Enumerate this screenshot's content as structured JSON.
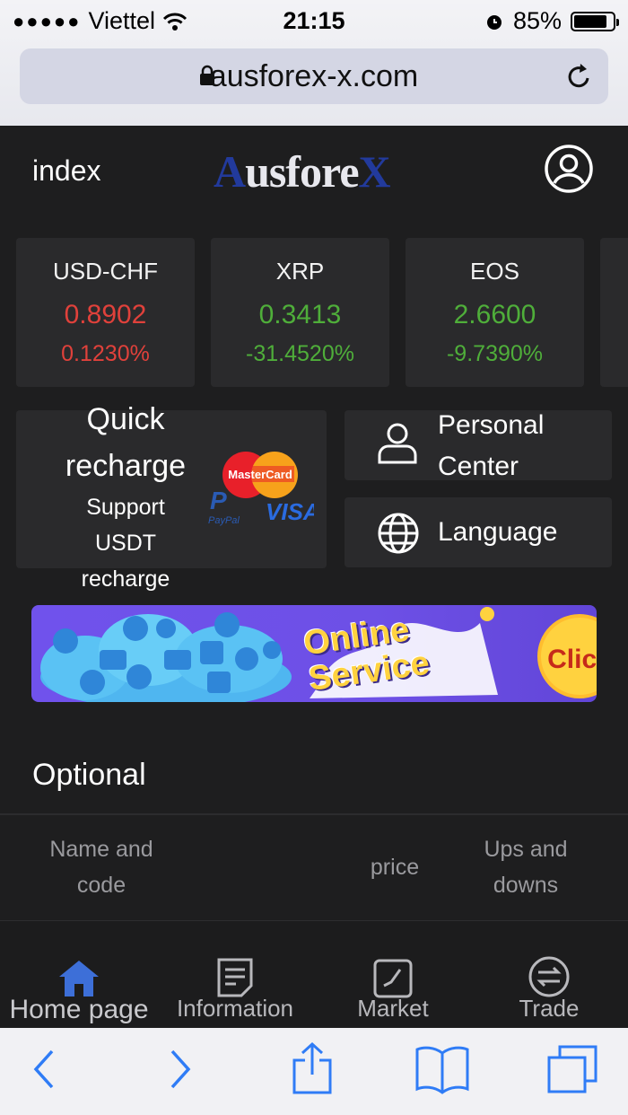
{
  "status_bar": {
    "carrier": "Viettel",
    "time": "21:15",
    "battery": "85%",
    "battery_level": 0.85
  },
  "browser": {
    "url": "ausforex-x.com"
  },
  "header": {
    "title": "index",
    "logo": "AusforeX",
    "logo_parts": [
      "A",
      "usfore",
      "X"
    ]
  },
  "tickers": [
    {
      "symbol": "USD-CHF",
      "price": "0.8902",
      "change": "0.1230%",
      "trend": "red"
    },
    {
      "symbol": "XRP",
      "price": "0.3413",
      "change": "-31.4520%",
      "trend": "green"
    },
    {
      "symbol": "EOS",
      "price": "2.6600",
      "change": "-9.7390%",
      "trend": "green"
    }
  ],
  "recharge": {
    "title_line1": "Quick",
    "title_line2": "recharge",
    "sub_line1": "Support",
    "sub_line2": "USDT",
    "sub_line3": "recharge",
    "card_icons": [
      "mastercard-icon",
      "paypal-icon",
      "visa-icon"
    ]
  },
  "personal_center": {
    "line1": "Personal",
    "line2": "Center",
    "icon": "user-icon"
  },
  "language": {
    "label": "Language",
    "icon": "globe-icon"
  },
  "banner": {
    "line1": "Online",
    "line2": "Service",
    "click_label": "Click"
  },
  "optional": {
    "title": "Optional",
    "col_name_line1": "Name and",
    "col_name_line2": "code",
    "col_price": "price",
    "col_ups_line1": "Ups and",
    "col_ups_line2": "downs"
  },
  "tabs": [
    {
      "label": "Home page",
      "icon": "home-icon",
      "active": true
    },
    {
      "label": "Information",
      "icon": "document-icon",
      "active": false
    },
    {
      "label": "Market",
      "icon": "chart-icon",
      "active": false
    },
    {
      "label": "Trade",
      "icon": "exchange-icon",
      "active": false
    }
  ],
  "colors": {
    "accent_blue": "#3d6fd8",
    "up_red": "#e0413b",
    "down_green": "#4fae3a",
    "background": "#1e1e1f",
    "card": "#2a2a2c"
  }
}
